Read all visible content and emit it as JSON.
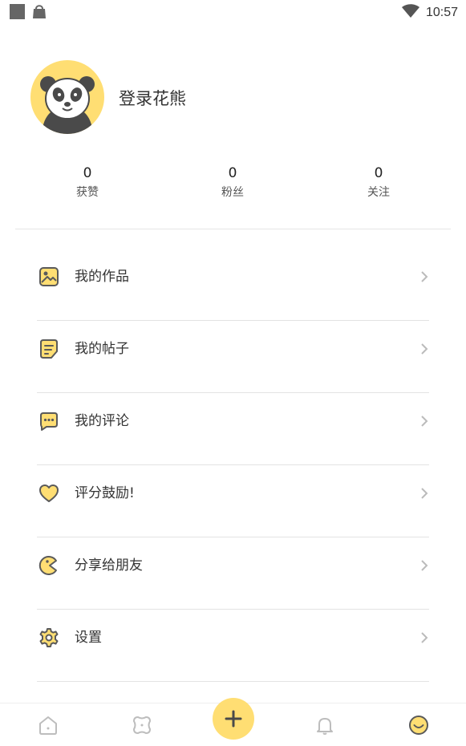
{
  "status_bar": {
    "time": "10:57",
    "icons": [
      "notification-square-icon",
      "bag-icon",
      "wifi-icon"
    ]
  },
  "profile": {
    "avatar_icon": "panda-avatar-icon",
    "login_text": "登录花熊",
    "stats": [
      {
        "count": "0",
        "label": "获赞"
      },
      {
        "count": "0",
        "label": "粉丝"
      },
      {
        "count": "0",
        "label": "关注"
      }
    ]
  },
  "menu": [
    {
      "label": "我的作品",
      "icon": "image-icon"
    },
    {
      "label": "我的帖子",
      "icon": "note-icon"
    },
    {
      "label": "我的评论",
      "icon": "comment-icon"
    },
    {
      "label": "评分鼓励!",
      "icon": "heart-icon"
    },
    {
      "label": "分享给朋友",
      "icon": "share-pacman-icon"
    },
    {
      "label": "设置",
      "icon": "settings-gear-icon"
    }
  ],
  "bottom_nav": {
    "tabs": [
      "home-icon",
      "discover-icon",
      "create-plus-icon",
      "bell-icon",
      "profile-smile-icon"
    ],
    "active": "profile-smile-icon"
  },
  "colors": {
    "accent": "#ffde73",
    "icon_stroke": "#5a5a5a",
    "divider": "#e3e3e3",
    "inactive_nav": "#bdbdbd"
  }
}
